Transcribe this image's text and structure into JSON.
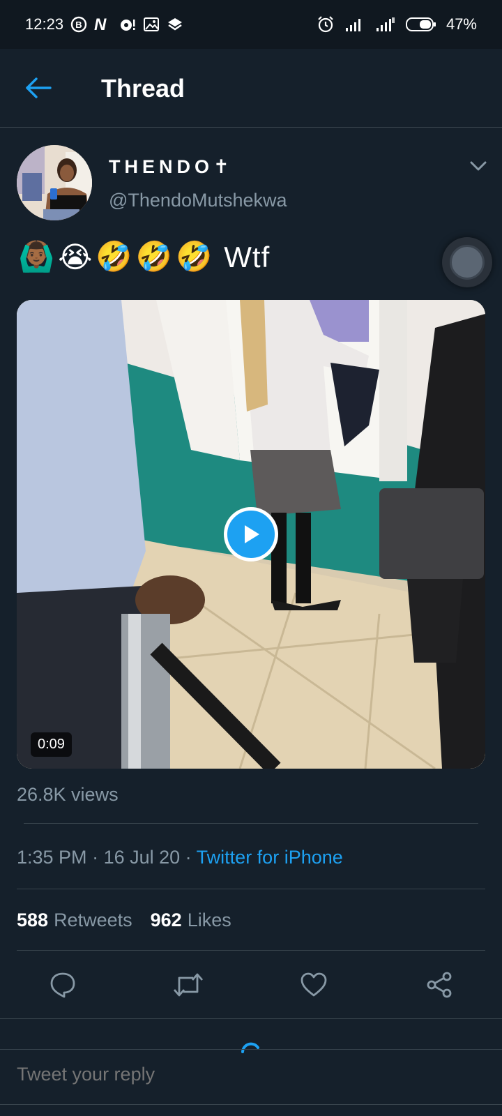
{
  "status_bar": {
    "time": "12:23",
    "battery": "47%",
    "left_icons": [
      "b-badge-icon",
      "n-app-icon",
      "notification-dot-icon",
      "gallery-icon",
      "layers-icon"
    ],
    "right_icons": [
      "alarm-icon",
      "signal-icon",
      "signal-icon",
      "battery-icon"
    ]
  },
  "header": {
    "title": "Thread",
    "back_icon": "back-arrow-icon"
  },
  "tweet": {
    "display_name": "THENDO✝︎",
    "handle": "@ThendoMutshekwa",
    "text_emojis": [
      "🙆🏾‍♂️",
      "😭",
      "🤣",
      "🤣",
      "🤣"
    ],
    "text_word": "Wtf",
    "video": {
      "duration": "0:09"
    },
    "views": "26.8K views",
    "time": "1:35 PM",
    "date": "16 Jul 20",
    "separator": " · ",
    "source": "Twitter for iPhone",
    "retweets_count": "588",
    "retweets_label": "Retweets",
    "likes_count": "962",
    "likes_label": "Likes"
  },
  "reply": {
    "placeholder": "Tweet your reply"
  },
  "colors": {
    "background": "#15202b",
    "accent": "#1da1f2",
    "secondary_text": "#8899a6",
    "divider": "#38444d"
  }
}
